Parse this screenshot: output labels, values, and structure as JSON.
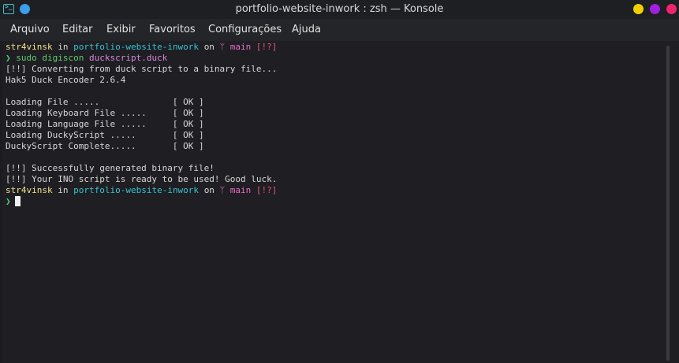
{
  "window": {
    "title": "portfolio-website-inwork : zsh — Konsole",
    "app_icon": "terminal-icon",
    "pin_color": "#3a9ee8",
    "buttons": [
      {
        "name": "minimize",
        "color": "#f5d000"
      },
      {
        "name": "maximize",
        "color": "#a020e0"
      },
      {
        "name": "close",
        "color": "#f0246c"
      }
    ]
  },
  "menu": {
    "items": [
      "Arquivo",
      "Editar",
      "Exibir",
      "Favoritos",
      "Configurações",
      "Ajuda"
    ]
  },
  "prompt": {
    "user": "str4vinsk",
    "in": "in",
    "path": "portfolio-website-inwork",
    "on": "on",
    "branch_icon": "ᛘ",
    "branch": "main",
    "status": "[!?]",
    "symbol": "❯"
  },
  "command": {
    "cmd": "sudo digiscon",
    "arg": "duckscript.duck"
  },
  "output": [
    "[!!] Converting from duck script to a binary file...",
    "Hak5 Duck Encoder 2.6.4",
    "",
    "Loading File .....              [ OK ]",
    "Loading Keyboard File .....     [ OK ]",
    "Loading Language File .....     [ OK ]",
    "Loading DuckyScript .....       [ OK ]",
    "DuckyScript Complete.....       [ OK ]",
    "",
    "[!!] Successfully generated binary file!",
    "[!!] Your INO script is ready to be used! Good luck."
  ],
  "colors": {
    "user": "#f4e38a",
    "path": "#35c3cf",
    "branch": "#e86cc6",
    "prompt_symbol": "#46d277",
    "background": "#1e1e23"
  }
}
